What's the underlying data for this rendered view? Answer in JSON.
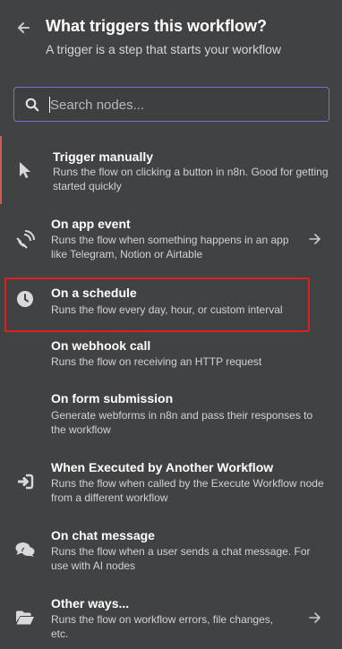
{
  "header": {
    "title": "What triggers this workflow?",
    "subtitle": "A trigger is a step that starts your workflow"
  },
  "search": {
    "placeholder": "Search nodes..."
  },
  "items": [
    {
      "name": "Trigger manually",
      "description": "Runs the flow on clicking a button in n8n. Good for getting started quickly",
      "icon": "cursor-icon"
    },
    {
      "name": "On app event",
      "description": "Runs the flow when something happens in an app like Telegram, Notion or Airtable",
      "icon": "satellite-dish-icon"
    },
    {
      "name": "On a schedule",
      "description": "Runs the flow every day, hour, or custom interval",
      "icon": "clock-icon"
    },
    {
      "name": "On webhook call",
      "description": "Runs the flow on receiving an HTTP request",
      "icon": "webhook-icon"
    },
    {
      "name": "On form submission",
      "description": "Generate webforms in n8n and pass their responses to the workflow",
      "icon": "form-icon"
    },
    {
      "name": "When Executed by Another Workflow",
      "description": "Runs the flow when called by the Execute Workflow node from a different workflow",
      "icon": "sign-in-icon"
    },
    {
      "name": "On chat message",
      "description": "Runs the flow when a user sends a chat message. For use with AI nodes",
      "icon": "chat-bubbles-icon"
    },
    {
      "name": "Other ways...",
      "description": "Runs the flow on workflow errors, file changes, etc.",
      "icon": "folder-open-icon"
    }
  ],
  "colors": {
    "background": "#414244",
    "search_border": "#7a6fd1",
    "active_indicator": "#d35a4e",
    "highlight_box": "#e02020"
  }
}
